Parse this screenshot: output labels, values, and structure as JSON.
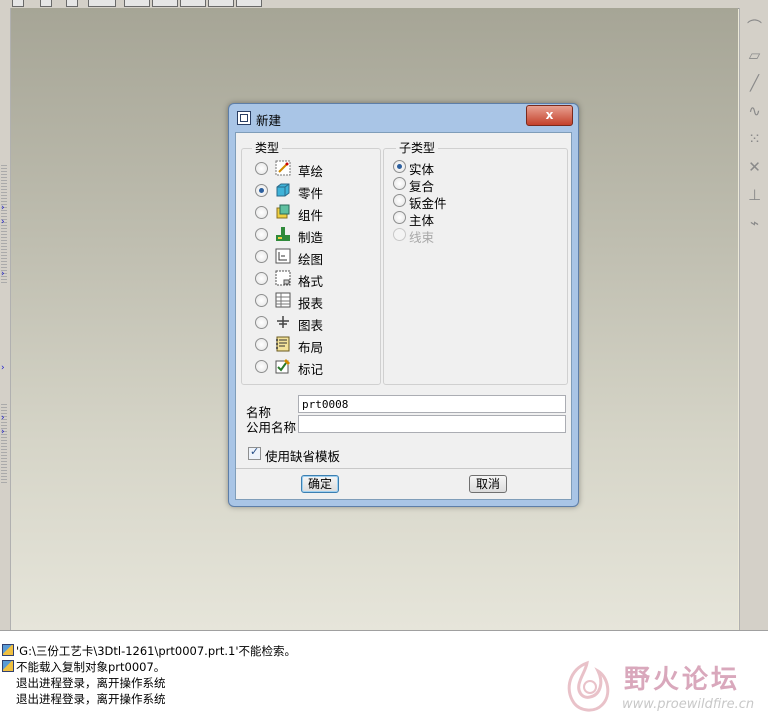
{
  "dialog": {
    "title": "新建",
    "close_label": "x",
    "type_group": {
      "label": "类型",
      "options": [
        {
          "label": "草绘",
          "icon": "sketch-icon",
          "selected": false
        },
        {
          "label": "零件",
          "icon": "part-icon",
          "selected": true
        },
        {
          "label": "组件",
          "icon": "assembly-icon",
          "selected": false
        },
        {
          "label": "制造",
          "icon": "manufacturing-icon",
          "selected": false
        },
        {
          "label": "绘图",
          "icon": "drawing-icon",
          "selected": false
        },
        {
          "label": "格式",
          "icon": "format-icon",
          "selected": false
        },
        {
          "label": "报表",
          "icon": "report-icon",
          "selected": false
        },
        {
          "label": "图表",
          "icon": "diagram-icon",
          "selected": false
        },
        {
          "label": "布局",
          "icon": "layout-icon",
          "selected": false
        },
        {
          "label": "标记",
          "icon": "markup-icon",
          "selected": false
        }
      ]
    },
    "subtype_group": {
      "label": "子类型",
      "options": [
        {
          "label": "实体",
          "selected": true,
          "enabled": true
        },
        {
          "label": "复合",
          "selected": false,
          "enabled": true
        },
        {
          "label": "钣金件",
          "selected": false,
          "enabled": true
        },
        {
          "label": "主体",
          "selected": false,
          "enabled": true
        },
        {
          "label": "线束",
          "selected": false,
          "enabled": false
        }
      ]
    },
    "name_label": "名称",
    "name_value": "prt0008",
    "common_name_label": "公用名称",
    "common_name_value": "",
    "use_default_template_label": "使用缺省模板",
    "use_default_template_checked": true,
    "ok_label": "确定",
    "cancel_label": "取消"
  },
  "messages": [
    {
      "icon": "message-icon",
      "text": "'G:\\三份工艺卡\\3Dtl-1261\\prt0007.prt.1'不能检索。"
    },
    {
      "icon": "message-icon",
      "text": "不能载入复制对象prt0007。"
    },
    {
      "icon": "",
      "text": "退出进程登录，离开操作系统"
    },
    {
      "icon": "",
      "text": "退出进程登录，离开操作系统"
    }
  ],
  "watermark": {
    "title": "野火论坛",
    "url": "www.proewildfire.cn"
  },
  "right_toolbar_icons": [
    "sketch-curve-icon",
    "datum-plane-icon",
    "datum-axis-icon",
    "spline-curve-icon",
    "datum-point-icon",
    "point-icon",
    "coordinate-system-icon",
    "analysis-icon"
  ]
}
